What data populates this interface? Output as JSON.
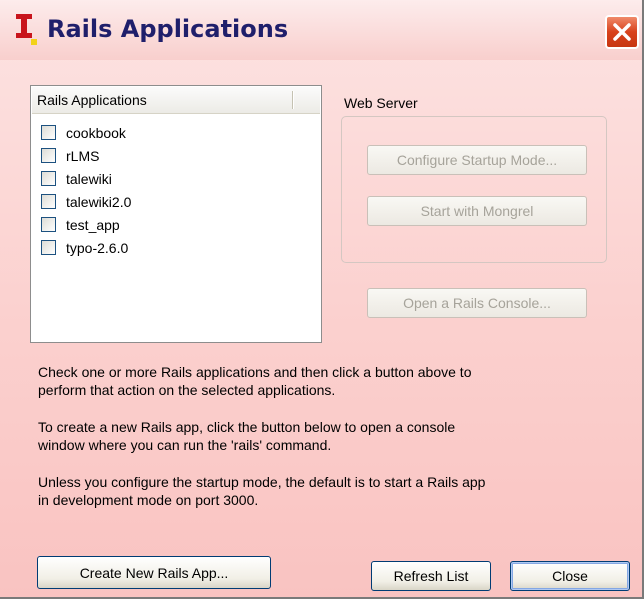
{
  "window": {
    "title": "Rails Applications"
  },
  "list": {
    "header": "Rails Applications",
    "items": [
      {
        "label": "cookbook",
        "checked": false
      },
      {
        "label": "rLMS",
        "checked": false
      },
      {
        "label": "talewiki",
        "checked": false
      },
      {
        "label": "talewiki2.0",
        "checked": false
      },
      {
        "label": "test_app",
        "checked": false
      },
      {
        "label": "typo-2.6.0",
        "checked": false
      }
    ]
  },
  "web_server": {
    "label": "Web Server",
    "configure_label": "Configure Startup Mode...",
    "start_label": "Start with Mongrel"
  },
  "console_label": "Open a Rails Console...",
  "help": {
    "line1": "Check one or more Rails applications and then click a button above to",
    "line2": "perform that action on the selected applications.",
    "line3": "To create a new Rails app, click the button below to open a console",
    "line4": "window where you can run the 'rails' command.",
    "line5": "Unless you configure the startup mode, the default is to start a Rails app",
    "line6": "in development mode on port 3000."
  },
  "buttons": {
    "create_label": "Create New Rails App...",
    "refresh_label": "Refresh List",
    "close_label": "Close"
  },
  "icons": {
    "app": "instantrails-logo-icon",
    "close": "close-x-icon"
  },
  "colors": {
    "background": "#fbd0ce",
    "title_text": "#1f1f6b",
    "close_button": "#d8421c",
    "logo_red": "#c8141c",
    "logo_yellow": "#f2d21a"
  }
}
